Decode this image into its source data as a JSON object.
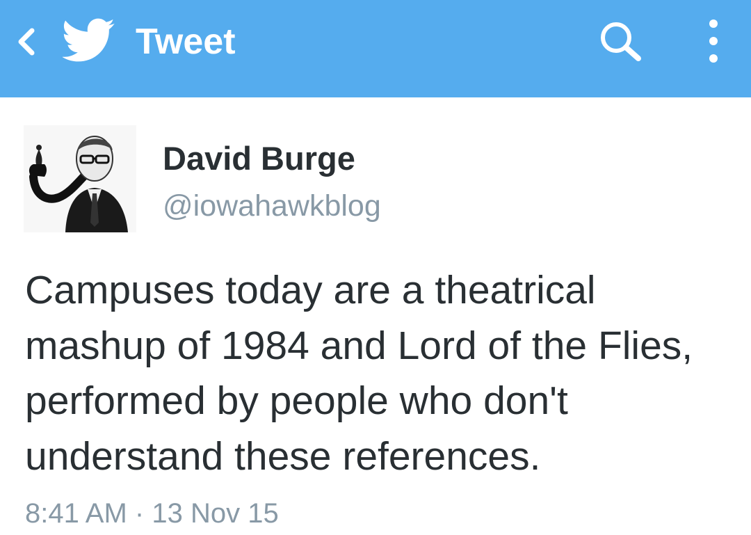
{
  "header": {
    "title": "Tweet",
    "background_color": "#55acee",
    "back_icon": "chevron-left-icon",
    "logo_icon": "twitter-bird-icon",
    "search_icon": "search-icon",
    "menu_icon": "vertical-dots-icon"
  },
  "tweet": {
    "author_name": "David Burge",
    "author_handle": "@iowahawkblog",
    "text_lines": [
      "Campuses today are a theatrical",
      "mashup of 1984 and Lord of the Flies,",
      "performed by people who don't",
      "understand these references."
    ],
    "time": "8:41 AM",
    "separator": "·",
    "date": "13 Nov 15"
  },
  "colors": {
    "text": "#292f33",
    "muted": "#8899a6",
    "brand": "#55acee"
  }
}
